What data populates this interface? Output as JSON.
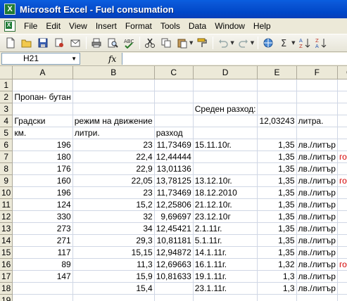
{
  "window": {
    "title": "Microsoft Excel - Fuel consumation"
  },
  "menu": [
    "File",
    "Edit",
    "View",
    "Insert",
    "Format",
    "Tools",
    "Data",
    "Window",
    "Help"
  ],
  "toolbar": {
    "icons": [
      "new-icon",
      "open-icon",
      "save-icon",
      "permission-icon",
      "email-icon",
      "print-icon",
      "print-preview-icon",
      "spelling-icon",
      "cut-icon",
      "copy-icon",
      "paste-icon",
      "format-painter-icon",
      "undo-icon",
      "redo-icon",
      "hyperlink-icon",
      "autosum-icon",
      "sort-ascending-icon",
      "sort-descending-icon"
    ]
  },
  "formula": {
    "name_box": "H21",
    "fx": "fx",
    "content": ""
  },
  "grid": {
    "columns": [
      "A",
      "B",
      "C",
      "D",
      "E",
      "F",
      "G"
    ],
    "rows": [
      {
        "n": "1",
        "cells": [
          "",
          "",
          "",
          "",
          "",
          "",
          ""
        ]
      },
      {
        "n": "2",
        "cells": [
          "Пропан- бутан",
          "",
          "",
          "",
          "",
          "",
          ""
        ]
      },
      {
        "n": "3",
        "cells": [
          "",
          "",
          "",
          "Среден разход:",
          "",
          "",
          ""
        ]
      },
      {
        "n": "4",
        "cells": [
          "Градски",
          "режим на движение",
          "",
          "",
          "12,03243",
          "литра.",
          ""
        ]
      },
      {
        "n": "5",
        "cells": [
          "км.",
          "литри.",
          "разход",
          "",
          "",
          "",
          ""
        ]
      },
      {
        "n": "6",
        "cells": [
          "196",
          "23",
          "11,73469",
          "15.11.10г.",
          "1,35",
          "лв./литър",
          ""
        ]
      },
      {
        "n": "7",
        "cells": [
          "180",
          "22,4",
          "12,44444",
          "",
          "1,35",
          "лв./литър",
          "гонки"
        ]
      },
      {
        "n": "8",
        "cells": [
          "176",
          "22,9",
          "13,01136",
          "",
          "1,35",
          "лв./литър",
          ""
        ]
      },
      {
        "n": "9",
        "cells": [
          "160",
          "22,05",
          "13,78125",
          "13.12.10г.",
          "1,35",
          "лв./литър",
          "гонки"
        ]
      },
      {
        "n": "10",
        "cells": [
          "196",
          "23",
          "11,73469",
          "18.12.2010",
          "1,35",
          "лв./литър",
          ""
        ]
      },
      {
        "n": "11",
        "cells": [
          "124",
          "15,2",
          "12,25806",
          "21.12.10г.",
          "1,35",
          "лв./литър",
          ""
        ]
      },
      {
        "n": "12",
        "cells": [
          "330",
          "32",
          "9,69697",
          "23.12.10г",
          "1,35",
          "лв./литър",
          ""
        ]
      },
      {
        "n": "13",
        "cells": [
          "273",
          "34",
          "12,45421",
          "2.1.11г.",
          "1,35",
          "лв./литър",
          ""
        ]
      },
      {
        "n": "14",
        "cells": [
          "271",
          "29,3",
          "10,81181",
          "5.1.11г.",
          "1,35",
          "лв./литър",
          ""
        ]
      },
      {
        "n": "15",
        "cells": [
          "117",
          "15,15",
          "12,94872",
          "14.1.11г.",
          "1,35",
          "лв./литър",
          ""
        ]
      },
      {
        "n": "16",
        "cells": [
          "89",
          "11,3",
          "12,69663",
          "16.1.11г.",
          "1,32",
          "лв./литър",
          "гонки"
        ]
      },
      {
        "n": "17",
        "cells": [
          "147",
          "15,9",
          "10,81633",
          "19.1.11г.",
          "1,3",
          "лв./литър",
          ""
        ]
      },
      {
        "n": "18",
        "cells": [
          "",
          "15,4",
          "",
          "23.1.11г.",
          "1,3",
          "лв./литър",
          ""
        ]
      },
      {
        "n": "19",
        "cells": [
          "",
          "",
          "",
          "",
          "",
          "",
          ""
        ]
      }
    ]
  },
  "colors": {
    "title_bar": "#0047c8",
    "warning_text": "#d40000"
  }
}
